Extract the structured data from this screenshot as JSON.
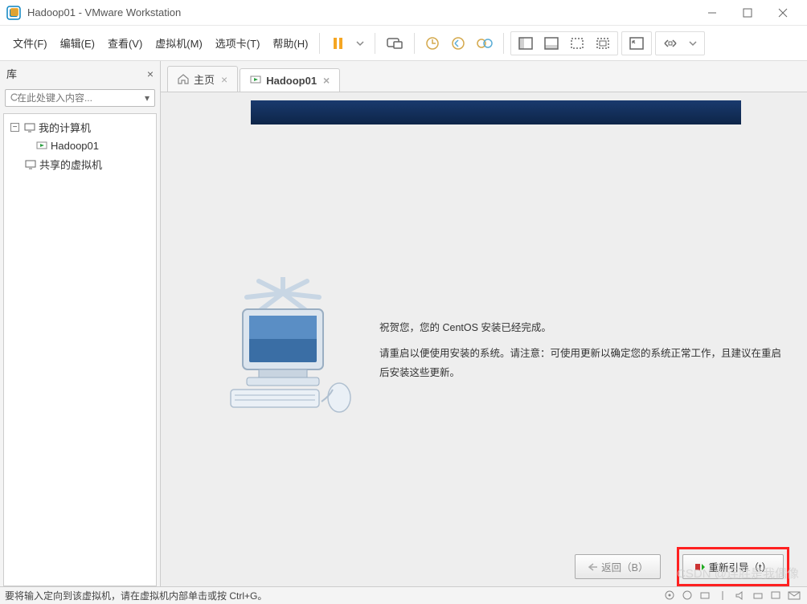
{
  "titlebar": {
    "title": "Hadoop01 - VMware Workstation"
  },
  "menubar": {
    "file": "文件(F)",
    "edit": "编辑(E)",
    "view": "查看(V)",
    "vm": "虚拟机(M)",
    "tabs": "选项卡(T)",
    "help": "帮助(H)"
  },
  "sidebar": {
    "title": "库",
    "search_placeholder": "在此处键入内容...",
    "tree": {
      "root": "我的计算机",
      "child": "Hadoop01",
      "shared": "共享的虚拟机"
    }
  },
  "tabs": {
    "home": "主页",
    "vm": "Hadoop01"
  },
  "installer": {
    "line1": "祝贺您，您的 CentOS 安装已经完成。",
    "line2": "请重启以便使用安装的系统。请注意：可使用更新以确定您的系统正常工作，且建议在重启后安装这些更新。",
    "back_btn": "返回（B）",
    "reboot_btn": "重新引导（t）"
  },
  "statusbar": {
    "hint": "要将输入定向到该虚拟机，请在虚拟机内部单击或按 Ctrl+G。"
  },
  "watermark": "CSDN @连胜是我偶像"
}
